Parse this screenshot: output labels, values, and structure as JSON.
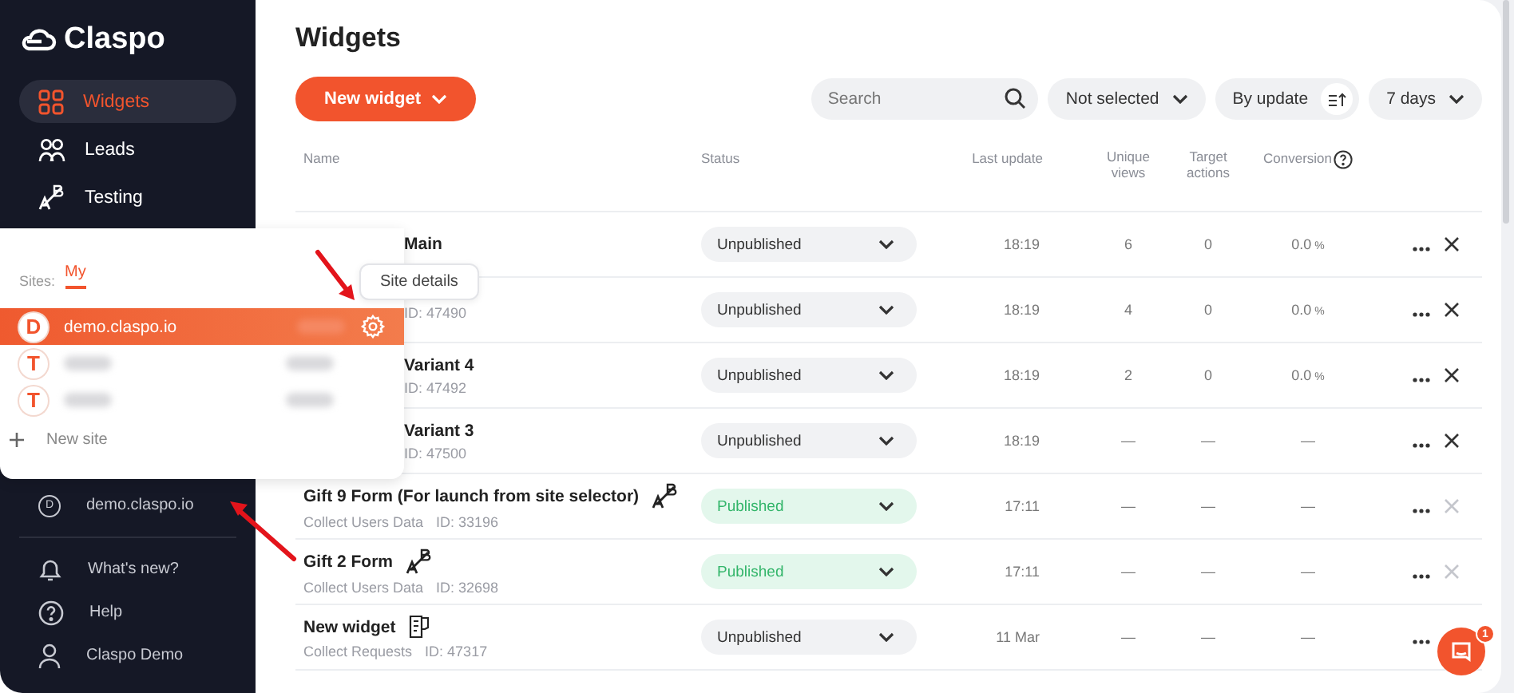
{
  "sidebar": {
    "logo": "Claspo",
    "nav": [
      {
        "label": "Widgets",
        "selected": true
      },
      {
        "label": "Leads",
        "selected": false
      },
      {
        "label": "Testing",
        "selected": false
      }
    ],
    "site_letter": "D",
    "site": "demo.claspo.io",
    "bottom": [
      {
        "label": "What's new?"
      },
      {
        "label": "Help"
      },
      {
        "label": "Claspo Demo"
      }
    ]
  },
  "site_popup": {
    "label": "Sites:",
    "tabs": [
      {
        "label": "My",
        "selected": true
      }
    ],
    "sites": [
      {
        "letter": "D",
        "name": "demo.claspo.io",
        "selected": true
      },
      {
        "letter": "T",
        "selected": false
      },
      {
        "letter": "T",
        "selected": false
      }
    ],
    "add": "New site",
    "tooltip": "Site details"
  },
  "page": {
    "title": "Widgets",
    "new_button": "New widget",
    "search": {
      "placeholder": "Search"
    },
    "filter": "Not selected",
    "sort": "By update",
    "period": "7 days"
  },
  "table": {
    "columns": [
      "Name",
      "Status",
      "Last update",
      "Unique views",
      "Target actions",
      "Conversion"
    ],
    "rows": [
      {
        "name": "Main",
        "meta": "",
        "covered": true,
        "status": "Unpublished",
        "published": false,
        "updated": "18:19",
        "views": "6",
        "actions": "0",
        "conversion": "0.0",
        "unit": "%",
        "delete_disabled": false
      },
      {
        "name": "",
        "meta": "ID: 47490",
        "covered": true,
        "status": "Unpublished",
        "published": false,
        "updated": "18:19",
        "views": "4",
        "actions": "0",
        "conversion": "0.0",
        "unit": "%",
        "delete_disabled": false
      },
      {
        "name": "Variant 4",
        "meta": "ID: 47492",
        "covered": true,
        "status": "Unpublished",
        "published": false,
        "updated": "18:19",
        "views": "2",
        "actions": "0",
        "conversion": "0.0",
        "unit": "%",
        "delete_disabled": false
      },
      {
        "name": "Variant 3",
        "meta": "ID: 47500",
        "covered": true,
        "status": "Unpublished",
        "published": false,
        "updated": "18:19",
        "views": "—",
        "actions": "—",
        "conversion": "—",
        "delete_disabled": false
      },
      {
        "name": "Gift 9 Form (For launch from site selector)",
        "kind": "ab",
        "meta": "Collect Users Data",
        "id": "ID: 33196",
        "covered": false,
        "status": "Published",
        "published": true,
        "updated": "17:11",
        "views": "—",
        "actions": "—",
        "conversion": "—",
        "delete_disabled": true
      },
      {
        "name": "Gift 2 Form",
        "kind": "ab",
        "meta": "Collect Users Data",
        "id": "ID: 32698",
        "covered": false,
        "status": "Published",
        "published": true,
        "updated": "17:11",
        "views": "—",
        "actions": "—",
        "conversion": "—",
        "delete_disabled": true
      },
      {
        "name": "New widget",
        "kind": "form",
        "meta": "Collect Requests",
        "id": "ID: 47317",
        "covered": false,
        "status": "Unpublished",
        "published": false,
        "updated": "11 Mar",
        "views": "—",
        "actions": "—",
        "conversion": "—",
        "delete_hidden": true
      }
    ]
  },
  "chat": {
    "badge": "1"
  }
}
